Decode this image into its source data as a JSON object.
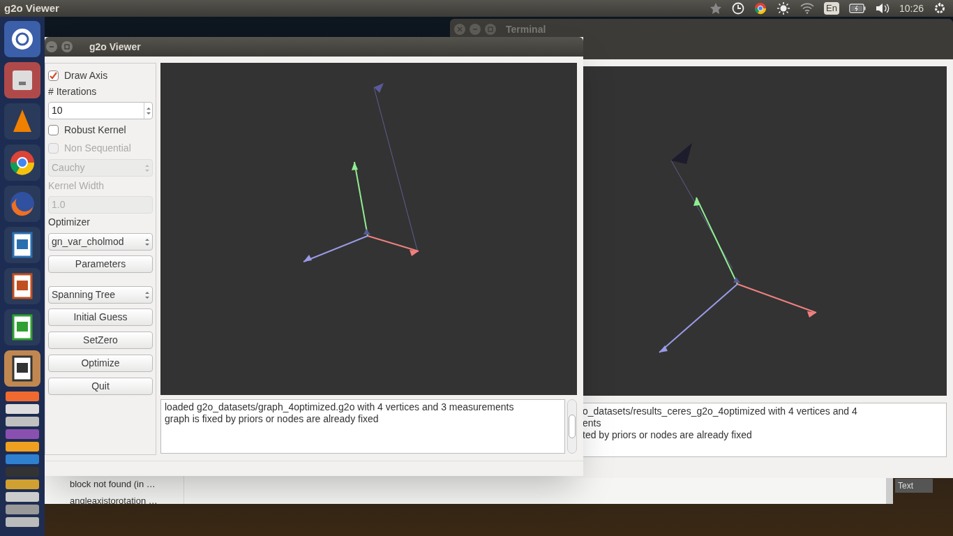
{
  "top_bar": {
    "app_title": "g2o Viewer",
    "keyboard_layout": "En",
    "clock": "10:26"
  },
  "terminal_window": {
    "title": "Terminal"
  },
  "back_viewer": {
    "log_lines": [
      "o_datasets/results_ceres_g2o_4optimized with 4 vertices and 4",
      "ents",
      "ted by priors or nodes are already fixed"
    ]
  },
  "background_window": {
    "list_items": [
      "block not found (in …",
      "angleaxistorotation …"
    ],
    "tag": "Text"
  },
  "viewer": {
    "title": "g2o Viewer",
    "controls_top": [
      {
        "kind": "checkbox",
        "label": "Draw Axis",
        "checked": true,
        "disabled": false
      },
      {
        "kind": "label",
        "text": "# Iterations",
        "disabled": false
      },
      {
        "kind": "spinbox",
        "value": "10",
        "disabled": false
      },
      {
        "kind": "checkbox",
        "label": "Robust Kernel",
        "checked": false,
        "disabled": false
      },
      {
        "kind": "checkbox",
        "label": "Non Sequential",
        "checked": false,
        "disabled": true
      },
      {
        "kind": "combo",
        "value": "Cauchy",
        "disabled": true
      },
      {
        "kind": "label",
        "text": "Kernel Width",
        "disabled": true
      },
      {
        "kind": "field",
        "value": "1.0",
        "disabled": true
      },
      {
        "kind": "label",
        "text": "Optimizer",
        "disabled": false
      },
      {
        "kind": "combo",
        "value": "gn_var_cholmod",
        "disabled": false
      },
      {
        "kind": "button",
        "label": "Parameters",
        "disabled": false
      }
    ],
    "controls_bottom": [
      {
        "kind": "combo",
        "value": "Spanning Tree",
        "disabled": false
      },
      {
        "kind": "button",
        "label": "Initial Guess",
        "disabled": false
      },
      {
        "kind": "button",
        "label": "SetZero",
        "disabled": false
      },
      {
        "kind": "button",
        "label": "Optimize",
        "disabled": false
      },
      {
        "kind": "button",
        "label": "Quit",
        "disabled": false
      }
    ],
    "log_lines": [
      "loaded g2o_datasets/graph_4optimized.g2o with 4 vertices and 3 measurements",
      "graph is fixed by priors or nodes are already fixed"
    ]
  }
}
